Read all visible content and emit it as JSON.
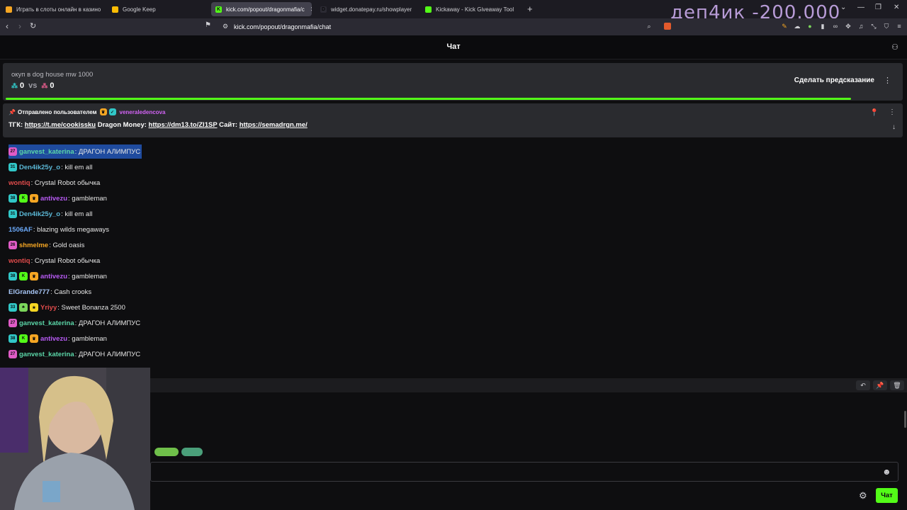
{
  "browser": {
    "tabs": [
      {
        "label": "Играть в слоты онлайн в казино",
        "fav_color": "#f5a623",
        "fav_char": ""
      },
      {
        "label": "Google Keep",
        "fav_color": "#fbbc04",
        "fav_char": ""
      },
      {
        "label": "kick.com/popout/dragonmafia/c",
        "fav_color": "#53fc18",
        "fav_char": "K"
      },
      {
        "label": "widget.donatepay.ru/showplayer",
        "fav_color": "#2b2a33",
        "fav_char": "D"
      },
      {
        "label": "Kickaway - Kick Giveaway Tool",
        "fav_color": "#53fc18",
        "fav_char": ""
      }
    ],
    "new_tab": "+",
    "url": "kick.com/popout/dragonmafia/chat",
    "overlay_title": "деп4ик -200.000"
  },
  "chat": {
    "header_title": "Чат",
    "prediction": {
      "question": "окуп в dog house mw 1000",
      "left_score": "0",
      "vs": "vs",
      "right_score": "0",
      "button": "Сделать предсказание",
      "progress": 0.945
    },
    "pinned": {
      "meta_prefix": "Отправлено пользователем",
      "user": "veneraledencova",
      "text_prefix": "ТГК:",
      "link1": "https://t.me/cookissku",
      "mid1": "Dragon Money:",
      "link2": "https://dm13.to/ZI1SP",
      "mid2": "Сайт:",
      "link3": "https://semadrgn.me/"
    },
    "messages": [
      {
        "user": "ganvest_katerina",
        "text": "ДРАГОН АЛИМПУС",
        "color": "#5bd6a8",
        "badges": [
          {
            "c": "#e05bc6",
            "t": "27"
          }
        ],
        "highlight": true
      },
      {
        "user": "Den4ik25y_o",
        "text": "kill em all",
        "color": "#5bb8d6",
        "badges": [
          {
            "c": "#31c7c7",
            "t": "31"
          }
        ]
      },
      {
        "user": "wontiq",
        "text": "Crystal Robot обычка",
        "color": "#e04b4b",
        "badges": []
      },
      {
        "user": "antivezu",
        "text": "gambleman",
        "color": "#b85bf5",
        "badges": [
          {
            "c": "#31c7c7",
            "t": "38"
          },
          {
            "c": "#53fc18",
            "t": "K"
          },
          {
            "c": "#f5a623",
            "t": "♛"
          }
        ]
      },
      {
        "user": "Den4ik25y_o",
        "text": "kill em all",
        "color": "#5bb8d6",
        "badges": [
          {
            "c": "#31c7c7",
            "t": "31"
          }
        ]
      },
      {
        "user": "1506AF",
        "text": "blazing wilds megaways",
        "color": "#6aa8f7",
        "badges": []
      },
      {
        "user": "shmelme",
        "text": "Gold oasis",
        "color": "#f5a623",
        "badges": [
          {
            "c": "#e05bc6",
            "t": "26"
          }
        ]
      },
      {
        "user": "wontiq",
        "text": "Crystal Robot обычка",
        "color": "#e04b4b",
        "badges": []
      },
      {
        "user": "antivezu",
        "text": "gambleman",
        "color": "#b85bf5",
        "badges": [
          {
            "c": "#31c7c7",
            "t": "38"
          },
          {
            "c": "#53fc18",
            "t": "K"
          },
          {
            "c": "#f5a623",
            "t": "♛"
          }
        ]
      },
      {
        "user": "ElGrande777",
        "text": "Cash crooks",
        "color": "#a8c7f7",
        "badges": []
      },
      {
        "user": "Yriyy",
        "text": "Sweet Bonanza 2500",
        "color": "#e04b4b",
        "badges": [
          {
            "c": "#31c7c7",
            "t": "33"
          },
          {
            "c": "#7bd65b",
            "t": "♣"
          },
          {
            "c": "#f5d623",
            "t": "★"
          }
        ]
      },
      {
        "user": "ganvest_katerina",
        "text": "ДРАГОН АЛИМПУС",
        "color": "#5bd6a8",
        "badges": [
          {
            "c": "#e05bc6",
            "t": "27"
          }
        ]
      },
      {
        "user": "antivezu",
        "text": "gambleman",
        "color": "#b85bf5",
        "badges": [
          {
            "c": "#31c7c7",
            "t": "38"
          },
          {
            "c": "#53fc18",
            "t": "K"
          },
          {
            "c": "#f5a623",
            "t": "♛"
          }
        ]
      },
      {
        "user": "ganvest_katerina",
        "text": "ДРАГОН АЛИМПУС",
        "color": "#5bd6a8",
        "badges": [
          {
            "c": "#e05bc6",
            "t": "27"
          }
        ]
      }
    ],
    "send_button": "Чат"
  }
}
